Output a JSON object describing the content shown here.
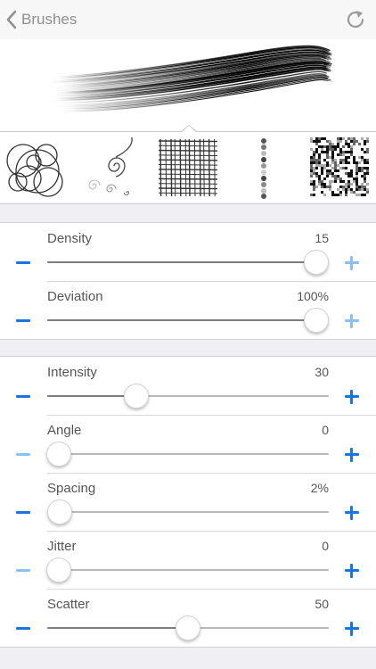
{
  "nav": {
    "back_label": "Brushes",
    "back_icon": "chevron-left-icon",
    "refresh_icon": "refresh-icon",
    "back_color": "#8e8e93"
  },
  "brushes": [
    {
      "name": "circles",
      "selected": false
    },
    {
      "name": "spirals",
      "selected": false
    },
    {
      "name": "crosshatch",
      "selected": true
    },
    {
      "name": "dots",
      "selected": false
    },
    {
      "name": "noise",
      "selected": false
    }
  ],
  "colors": {
    "accent": "#1a74e4",
    "accent_disabled": "#8cc0f5"
  },
  "groups": [
    {
      "sliders": [
        {
          "label": "Density",
          "value": "15",
          "level": 0.955,
          "minus_enabled": true,
          "plus_enabled": false
        },
        {
          "label": "Deviation",
          "value": "100%",
          "level": 0.955,
          "minus_enabled": true,
          "plus_enabled": false
        }
      ]
    },
    {
      "sliders": [
        {
          "label": "Intensity",
          "value": "30",
          "level": 0.315,
          "minus_enabled": true,
          "plus_enabled": true
        },
        {
          "label": "Angle",
          "value": "0",
          "level": 0.04,
          "minus_enabled": false,
          "plus_enabled": true
        },
        {
          "label": "Spacing",
          "value": "2%",
          "level": 0.045,
          "minus_enabled": true,
          "plus_enabled": true
        },
        {
          "label": "Jitter",
          "value": "0",
          "level": 0.04,
          "minus_enabled": false,
          "plus_enabled": true
        },
        {
          "label": "Scatter",
          "value": "50",
          "level": 0.5,
          "minus_enabled": true,
          "plus_enabled": true
        }
      ]
    }
  ]
}
